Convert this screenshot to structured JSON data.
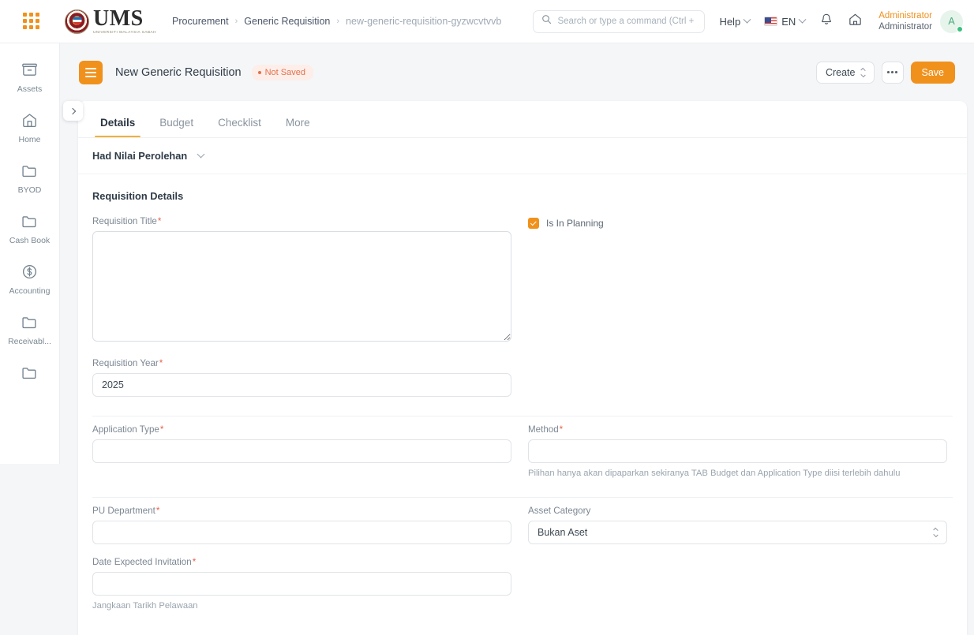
{
  "navbar": {
    "apps_icon": "apps-grid-icon",
    "brand": {
      "wordmark": "UMS",
      "subtitle": "UNIVERSITI MALAYSIA SABAH"
    },
    "breadcrumb": [
      {
        "label": "Procurement",
        "muted": false
      },
      {
        "label": "Generic Requisition",
        "muted": false
      },
      {
        "label": "new-generic-requisition-gyzwcvtvvb",
        "muted": true
      }
    ],
    "separator": "›",
    "search": {
      "placeholder": "Search or type a command (Ctrl + G)",
      "value": "",
      "icon": "search-icon"
    },
    "help_label": "Help",
    "language_label": "EN",
    "notification_icon": "bell-icon",
    "home_icon": "home-icon",
    "user": {
      "name": "Administrator",
      "role": "Administrator",
      "avatar_initial": "A"
    }
  },
  "sidebar": {
    "items": [
      {
        "label": "Assets",
        "icon": "archive-box-icon"
      },
      {
        "label": "Home",
        "icon": "home-icon"
      },
      {
        "label": "BYOD",
        "icon": "folder-icon"
      },
      {
        "label": "Cash Book",
        "icon": "folder-icon"
      },
      {
        "label": "Accounting",
        "icon": "dollar-circle-icon"
      },
      {
        "label": "Receivabl...",
        "icon": "folder-icon"
      },
      {
        "label": "",
        "icon": "folder-icon"
      }
    ],
    "expand_icon": "chevron-right-icon"
  },
  "toolbar": {
    "menu_icon": "hamburger-menu-icon",
    "doc_title": "New Generic Requisition",
    "status_badge": "Not Saved",
    "create_label": "Create",
    "more_icon": "ellipsis-icon",
    "save_label": "Save"
  },
  "tabs": [
    {
      "label": "Details",
      "active": true
    },
    {
      "label": "Budget",
      "active": false
    },
    {
      "label": "Checklist",
      "active": false
    },
    {
      "label": "More",
      "active": false
    }
  ],
  "collapsible": {
    "title": "Had Nilai Perolehan",
    "chevron": "chevron-down-icon"
  },
  "form": {
    "section_title": "Requisition Details",
    "requisition_title": {
      "label": "Requisition Title",
      "required": true,
      "value": "",
      "placeholder": ""
    },
    "is_in_planning": {
      "label": "Is In Planning",
      "checked": true
    },
    "requisition_year": {
      "label": "Requisition Year",
      "required": true,
      "value": "2025"
    },
    "application_type": {
      "label": "Application Type",
      "required": true,
      "value": "",
      "placeholder": ""
    },
    "method": {
      "label": "Method",
      "required": true,
      "value": "",
      "placeholder": "",
      "help": "Pilihan hanya akan dipaparkan sekiranya TAB Budget dan Application Type diisi terlebih dahulu"
    },
    "pu_department": {
      "label": "PU Department",
      "required": true,
      "value": "",
      "placeholder": ""
    },
    "asset_category": {
      "label": "Asset Category",
      "required": false,
      "value": "Bukan Aset"
    },
    "date_expected_invitation": {
      "label": "Date Expected Invitation",
      "required": true,
      "value": "",
      "placeholder": "",
      "help": "Jangkaan Tarikh Pelawaan"
    }
  },
  "colors": {
    "accent": "#f0911c",
    "tab_underline": "#f0b03c",
    "required": "#e8614d",
    "status_badge": "#e2714d"
  }
}
